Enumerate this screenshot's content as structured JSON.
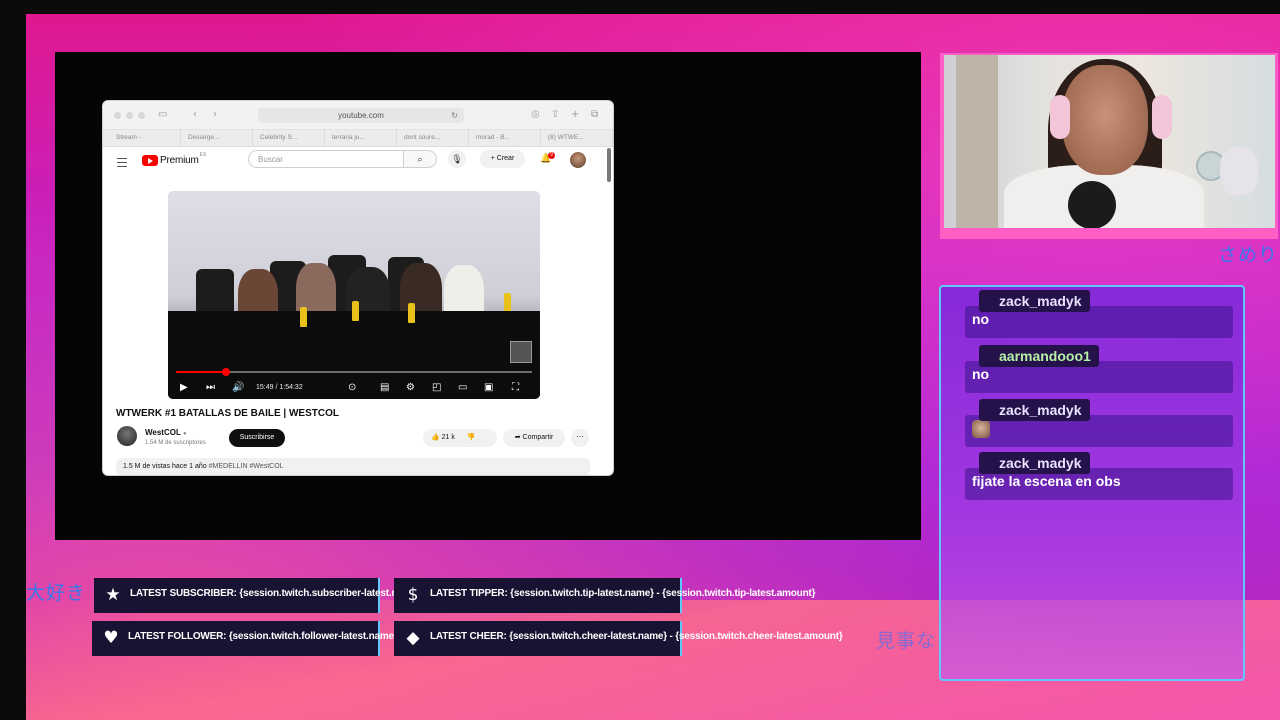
{
  "overlay": {
    "jp_top_right": "さめり",
    "jp_left": "大好き",
    "jp_bottom_right": "見事な"
  },
  "browser": {
    "url": "youtube.com",
    "tabs": [
      "Stream -",
      "Desiarge...",
      "Celebrity S...",
      "terraria ju...",
      "dont soure...",
      "morad - B...",
      "(8) WTWE..."
    ],
    "logo_text": "Premium",
    "logo_region": "ES",
    "search_placeholder": "Buscar",
    "create_label": "Crear",
    "notification_count": "9",
    "video": {
      "time": "15:49 / 1:54:32",
      "progress": 0.14
    },
    "video_title": "WTWERK #1 BATALLAS DE BAILE | WESTCOL",
    "channel_name": "WestCOL",
    "channel_subs": "1.54 M de suscriptores",
    "subscribe_label": "Suscribirse",
    "likes": "21 k",
    "share_label": "Compartir",
    "more_label": "···",
    "description_meta": "1.5 M de vistas  hace 1 año",
    "description_tags": "#MEDELLIN #WestCOL"
  },
  "chat": {
    "messages": [
      {
        "user": "zack_madyk",
        "text": "no",
        "user_color": "#e8e2ff"
      },
      {
        "user": "aarmandooo1",
        "text": "no",
        "user_color": "#b6f1a6"
      },
      {
        "user": "zack_madyk",
        "text": "",
        "emote": "cat-emote",
        "user_color": "#e8e2ff"
      },
      {
        "user": "zack_madyk",
        "text": "fijate la escena en obs",
        "user_color": "#e8e2ff"
      }
    ]
  },
  "alerts": {
    "subscriber": {
      "label": "LATEST SUBSCRIBER: {session.twitch.subscriber-latest.name}",
      "icon": "star-icon"
    },
    "tipper": {
      "label": "LATEST TIPPER: {session.twitch.tip-latest.name} - {session.twitch.tip-latest.amount}",
      "icon": "dollar-icon"
    },
    "follower": {
      "label": "LATEST FOLLOWER: {session.twitch.follower-latest.name}",
      "icon": "heart-icon"
    },
    "cheer": {
      "label": "LATEST CHEER: {session.twitch.cheer-latest.name} - {session.twitch.cheer-latest.amount}",
      "icon": "diamond-icon"
    }
  },
  "colors": {
    "accent": "#5ec8ff",
    "overlay_magenta": "#e0188f",
    "overlay_purple": "#a524d8",
    "youtube_red": "#ff0000"
  }
}
